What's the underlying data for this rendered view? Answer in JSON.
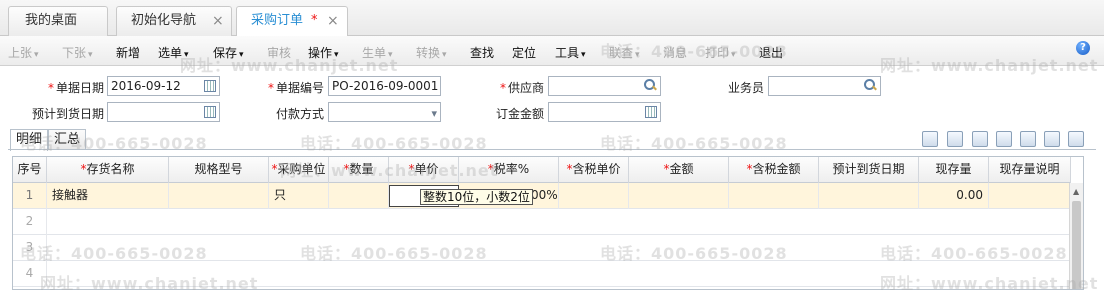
{
  "tabs": [
    {
      "label": "我的桌面",
      "closable": false,
      "active": false
    },
    {
      "label": "初始化导航",
      "closable": true,
      "active": false
    },
    {
      "label": "采购订单",
      "modified_mark": "*",
      "closable": true,
      "active": true
    }
  ],
  "toolbar": {
    "items": [
      {
        "label": "上张",
        "caret": "▾",
        "disabled": true
      },
      {
        "label": "下张",
        "caret": "▾",
        "disabled": true
      },
      {
        "label": "新增",
        "caret": "",
        "disabled": false
      },
      {
        "label": "选单",
        "caret": "▾",
        "disabled": false
      },
      {
        "label": "保存",
        "caret": "▾",
        "disabled": false
      },
      {
        "label": "审核",
        "caret": "",
        "disabled": true
      },
      {
        "label": "操作",
        "caret": "▾",
        "disabled": false
      },
      {
        "label": "生单",
        "caret": "▾",
        "disabled": true
      },
      {
        "label": "转换",
        "caret": "▾",
        "disabled": true
      },
      {
        "label": "查找",
        "caret": "",
        "disabled": false
      },
      {
        "label": "定位",
        "caret": "",
        "disabled": false
      },
      {
        "label": "工具",
        "caret": "▾",
        "disabled": false
      },
      {
        "label": "联查",
        "caret": "▾",
        "disabled": true
      },
      {
        "label": "消息",
        "caret": "",
        "disabled": true
      },
      {
        "label": "打印",
        "caret": "▾",
        "disabled": true
      },
      {
        "label": "退出",
        "caret": "",
        "disabled": false
      }
    ],
    "help_icon": "?"
  },
  "form": {
    "required_mark": "*",
    "doc_date": {
      "label": "单据日期",
      "value": "2016-09-12"
    },
    "doc_no": {
      "label": "单据编号",
      "value": "PO-2016-09-0001"
    },
    "supplier": {
      "label": "供应商",
      "value": ""
    },
    "salesman": {
      "label": "业务员",
      "value": ""
    },
    "arrival_date": {
      "label": "预计到货日期",
      "value": ""
    },
    "payment": {
      "label": "付款方式",
      "value": "",
      "caret": "▾"
    },
    "deposit": {
      "label": "订金金额",
      "value": ""
    }
  },
  "subtabs": [
    {
      "label": "明细",
      "active": true
    },
    {
      "label": "汇总",
      "active": false
    }
  ],
  "grid_icons": [
    "copy-icon",
    "paste-icon",
    "excel-icon",
    "search-icon",
    "preview-icon",
    "export-icon",
    "save-icon"
  ],
  "grid": {
    "columns": [
      {
        "label": "序号",
        "required": false
      },
      {
        "label": "存货名称",
        "required": true
      },
      {
        "label": "规格型号",
        "required": false
      },
      {
        "label": "采购单位",
        "required": true
      },
      {
        "label": "数量",
        "required": true
      },
      {
        "label": "单价",
        "required": true
      },
      {
        "label": "税率%",
        "required": true
      },
      {
        "label": "含税单价",
        "required": true
      },
      {
        "label": "金额",
        "required": true
      },
      {
        "label": "含税金额",
        "required": true
      },
      {
        "label": "预计到货日期",
        "required": false
      },
      {
        "label": "现存量",
        "required": false
      },
      {
        "label": "现存量说明",
        "required": false
      }
    ],
    "rows": [
      {
        "no": "1",
        "name": "接触器",
        "spec": "",
        "unit": "只",
        "qty": "",
        "price": "",
        "tax": "00%",
        "tprice": "",
        "amount": "",
        "tamount": "",
        "date": "",
        "stock": "0.00",
        "stocknote": ""
      },
      {
        "no": "2"
      },
      {
        "no": "3"
      },
      {
        "no": "4"
      }
    ],
    "tooltip": "整数10位，小数2位"
  },
  "watermark": {
    "phone": "电话：400-665-0028",
    "site": "网址：www.chanjet.net"
  }
}
